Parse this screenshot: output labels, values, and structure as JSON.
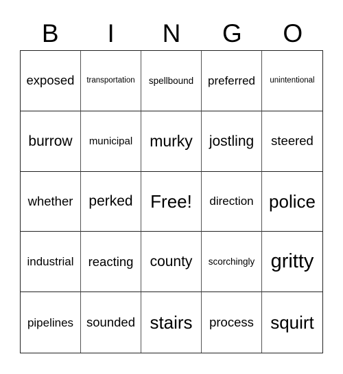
{
  "header": [
    "B",
    "I",
    "N",
    "G",
    "O"
  ],
  "rows": [
    [
      "exposed",
      "transportation",
      "spellbound",
      "preferred",
      "unintentional"
    ],
    [
      "burrow",
      "municipal",
      "murky",
      "jostling",
      "steered"
    ],
    [
      "whether",
      "perked",
      "Free!",
      "direction",
      "police"
    ],
    [
      "industrial",
      "reacting",
      "county",
      "scorchingly",
      "gritty"
    ],
    [
      "pipelines",
      "sounded",
      "stairs",
      "process",
      "squirt"
    ]
  ]
}
